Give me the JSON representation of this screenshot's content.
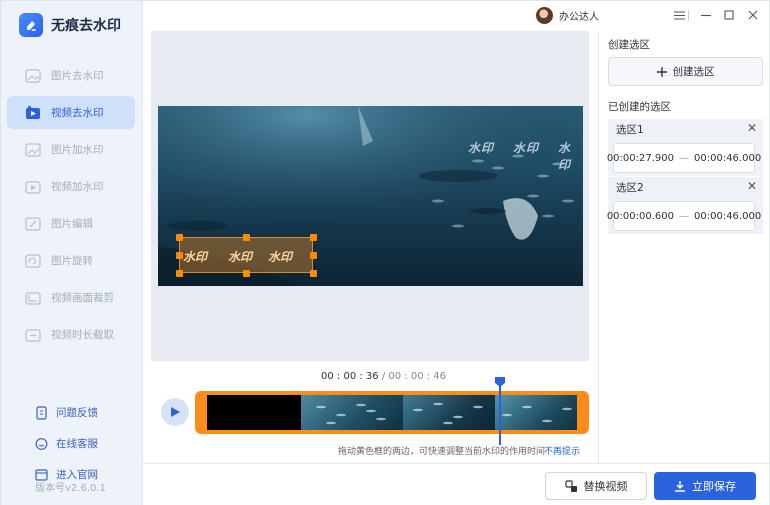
{
  "app": {
    "title": "无痕去水印"
  },
  "sidebar": {
    "items": [
      {
        "label": "图片去水印",
        "icon": "image-icon"
      },
      {
        "label": "视频去水印",
        "icon": "video-icon"
      },
      {
        "label": "图片加水印",
        "icon": "image-add-icon"
      },
      {
        "label": "视频加水印",
        "icon": "video-add-icon"
      },
      {
        "label": "图片编辑",
        "icon": "image-edit-icon"
      },
      {
        "label": "图片旋转",
        "icon": "image-rotate-icon"
      },
      {
        "label": "视频画面裁剪",
        "icon": "video-crop-icon"
      },
      {
        "label": "视频时长截取",
        "icon": "video-trim-icon"
      }
    ],
    "active_index": 1,
    "links": [
      {
        "label": "问题反馈",
        "icon": "feedback-icon"
      },
      {
        "label": "在线客服",
        "icon": "chat-icon"
      },
      {
        "label": "进入官网",
        "icon": "website-icon"
      }
    ],
    "version": "版本号v2.6.0.1"
  },
  "topbar": {
    "user_name": "办公达人"
  },
  "video": {
    "watermark_text": "水印",
    "selection_watermark": "水印"
  },
  "playback": {
    "current_time": "00 : 00 : 36",
    "separator": " / ",
    "total_time": "00 : 00 : 46",
    "progress": 0.78
  },
  "hint": {
    "text": "拖动黄色框的两边，可快速调整当前水印的作用时间",
    "link": "不再提示"
  },
  "panel": {
    "create_heading": "创建选区",
    "create_button": "创建选区",
    "created_heading": "已创建的选区",
    "regions": [
      {
        "title": "选区1",
        "start": "00:00:27.900",
        "end": "00:00:46.000"
      },
      {
        "title": "选区2",
        "start": "00:00:00.600",
        "end": "00:00:46.000"
      }
    ],
    "range_dash": "—"
  },
  "footer": {
    "replace_button": "替换视频",
    "save_button": "立即保存"
  },
  "colors": {
    "accent": "#2b63de",
    "timeline_border": "#ff8c1a",
    "active_nav_bg": "#cfe0fa"
  }
}
